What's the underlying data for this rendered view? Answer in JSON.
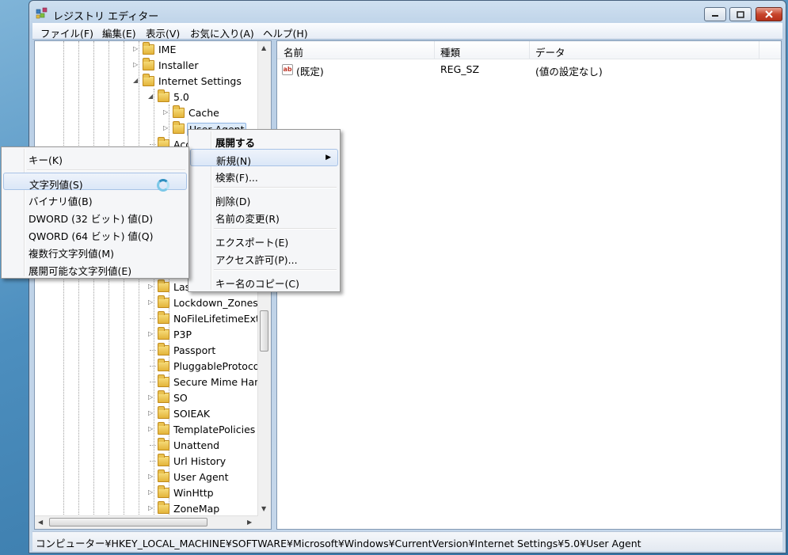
{
  "window": {
    "title": "レジストリ エディター"
  },
  "menubar": [
    "ファイル(F)",
    "編集(E)",
    "表示(V)",
    "お気に入り(A)",
    "ヘルプ(H)"
  ],
  "tree": {
    "nodes": [
      {
        "label": "IME",
        "level": 0,
        "expander": "collapsed"
      },
      {
        "label": "Installer",
        "level": 0,
        "expander": "collapsed"
      },
      {
        "label": "Internet Settings",
        "level": 0,
        "expander": "expanded"
      },
      {
        "label": "5.0",
        "level": 1,
        "expander": "expanded"
      },
      {
        "label": "Cache",
        "level": 2,
        "expander": "collapsed"
      },
      {
        "label": "User Agent",
        "level": 2,
        "expander": "collapsed",
        "selected": true
      },
      {
        "label": "Acc",
        "level": 1,
        "expander": "none"
      },
      {
        "label": "Las",
        "level": 1,
        "expander": "collapsed"
      },
      {
        "label": "Lockdown_Zones",
        "level": 1,
        "expander": "collapsed"
      },
      {
        "label": "NoFileLifetimeExte",
        "level": 1,
        "expander": "none"
      },
      {
        "label": "P3P",
        "level": 1,
        "expander": "collapsed"
      },
      {
        "label": "Passport",
        "level": 1,
        "expander": "none"
      },
      {
        "label": "PluggableProtocols",
        "level": 1,
        "expander": "none"
      },
      {
        "label": "Secure Mime Hand",
        "level": 1,
        "expander": "none"
      },
      {
        "label": "SO",
        "level": 1,
        "expander": "collapsed"
      },
      {
        "label": "SOIEAK",
        "level": 1,
        "expander": "collapsed"
      },
      {
        "label": "TemplatePolicies",
        "level": 1,
        "expander": "collapsed"
      },
      {
        "label": "Unattend",
        "level": 1,
        "expander": "none"
      },
      {
        "label": "Url History",
        "level": 1,
        "expander": "none"
      },
      {
        "label": "User Agent",
        "level": 1,
        "expander": "collapsed"
      },
      {
        "label": "WinHttp",
        "level": 1,
        "expander": "collapsed"
      },
      {
        "label": "ZoneMap",
        "level": 1,
        "expander": "collapsed"
      }
    ]
  },
  "list": {
    "columns": [
      "名前",
      "種類",
      "データ"
    ],
    "rows": [
      {
        "name": "(既定)",
        "type": "REG_SZ",
        "data": "(値の設定なし)"
      }
    ]
  },
  "context_menu": {
    "items": [
      "展開する",
      "新規(N)",
      "検索(F)...",
      "削除(D)",
      "名前の変更(R)",
      "エクスポート(E)",
      "アクセス許可(P)...",
      "キー名のコピー(C)"
    ]
  },
  "new_submenu": {
    "items": [
      "キー(K)",
      "文字列値(S)",
      "バイナリ値(B)",
      "DWORD (32 ビット) 値(D)",
      "QWORD (64 ビット) 値(Q)",
      "複数行文字列値(M)",
      "展開可能な文字列値(E)"
    ]
  },
  "status": {
    "path": "コンピューター¥HKEY_LOCAL_MACHINE¥SOFTWARE¥Microsoft¥Windows¥CurrentVersion¥Internet Settings¥5.0¥User Agent"
  },
  "colors": {
    "titlebar": "#b9cfe6",
    "highlight": "#dbe7f7",
    "folder": "#e3b43a",
    "close_button": "#c7452c"
  }
}
